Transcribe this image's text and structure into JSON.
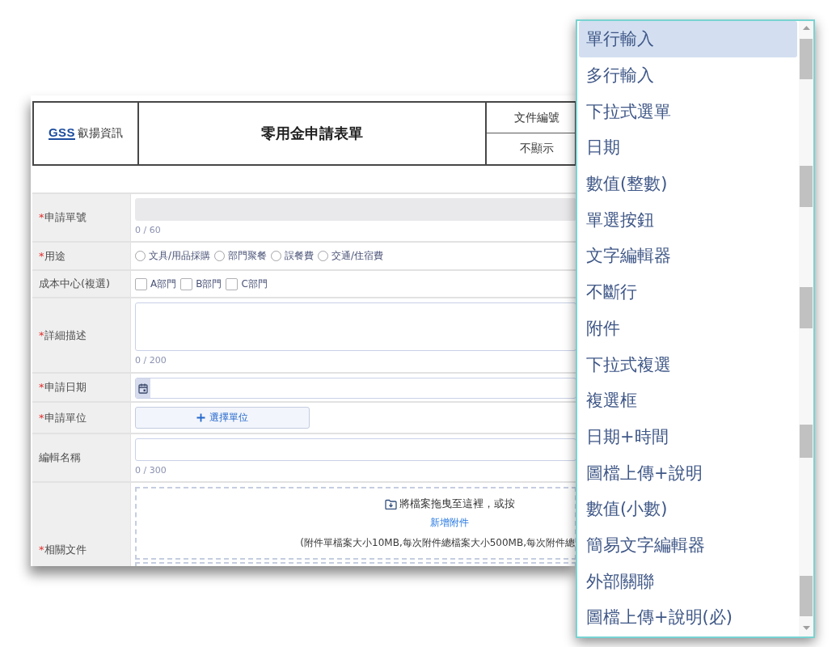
{
  "header": {
    "logo_mark": "GSS",
    "company": "叡揚資訊",
    "title": "零用金申請表單",
    "doc_number_label": "文件編號",
    "doc_number_value": "不顯示"
  },
  "form": {
    "fields": [
      {
        "kind": "text",
        "required_mark": "*",
        "label": "申請單號",
        "disabled": true,
        "counter": "0 / 60"
      },
      {
        "kind": "radio",
        "required_mark": "*",
        "label": "用途",
        "options": [
          {
            "label": "文具/用品採購",
            "selected": false
          },
          {
            "label": "部門聚餐",
            "selected": false
          },
          {
            "label": "誤餐費",
            "selected": false
          },
          {
            "label": "交通/住宿費",
            "selected": false
          }
        ]
      },
      {
        "kind": "checkbox",
        "label": "成本中心(複選)",
        "options": [
          {
            "label": "A部門",
            "checked": false
          },
          {
            "label": "B部門",
            "checked": false
          },
          {
            "label": "C部門",
            "checked": false
          }
        ]
      },
      {
        "kind": "textarea",
        "required_mark": "*",
        "label": "詳細描述",
        "counter": "0 / 200"
      },
      {
        "kind": "date",
        "required_mark": "*",
        "label": "申請日期"
      },
      {
        "kind": "picker",
        "required_mark": "*",
        "label": "申請單位",
        "button": "選擇單位"
      },
      {
        "kind": "text",
        "label": "編輯名稱",
        "disabled": false,
        "counter": "0 / 300"
      },
      {
        "kind": "upload",
        "required_mark": "*",
        "label": "相關文件",
        "prompt": "將檔案拖曳至這裡，或按",
        "link": "新增附件",
        "note": "(附件單檔案大小10MB,每次附件總檔案大小500MB,每次附件總"
      }
    ]
  },
  "dropdown": {
    "items": [
      {
        "label": "單行輸入",
        "selected": true
      },
      {
        "label": "多行輸入",
        "selected": false
      },
      {
        "label": "下拉式選單",
        "selected": false
      },
      {
        "label": "日期",
        "selected": false
      },
      {
        "label": "數值(整數)",
        "selected": false
      },
      {
        "label": "單選按鈕",
        "selected": false
      },
      {
        "label": "文字編輯器",
        "selected": false
      },
      {
        "label": "不斷行",
        "selected": false
      },
      {
        "label": "附件",
        "selected": false
      },
      {
        "label": "下拉式複選",
        "selected": false
      },
      {
        "label": "複選框",
        "selected": false
      },
      {
        "label": "日期+時間",
        "selected": false
      },
      {
        "label": "圖檔上傳+說明",
        "selected": false
      },
      {
        "label": "數值(小數)",
        "selected": false
      },
      {
        "label": "簡易文字編輯器",
        "selected": false
      },
      {
        "label": "外部關聯",
        "selected": false
      },
      {
        "label": "圖檔上傳+說明(必)",
        "selected": false
      }
    ]
  }
}
